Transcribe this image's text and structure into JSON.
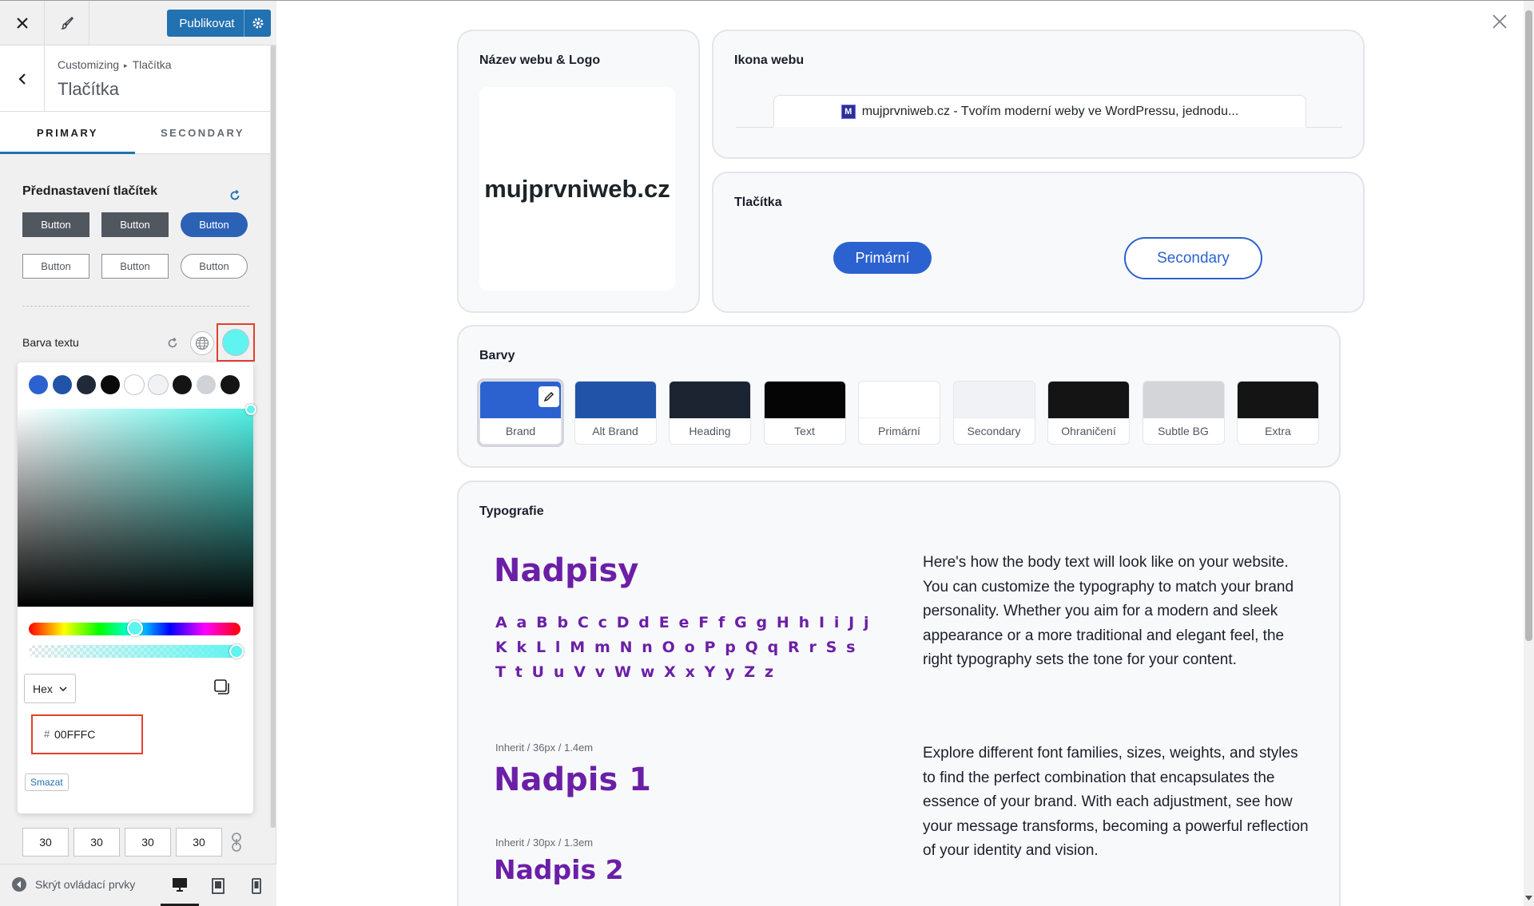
{
  "topbar": {
    "close_icon": "close-icon",
    "brush_icon": "paintbrush-icon",
    "publish_label": "Publikovat",
    "publish_settings_icon": "gear-icon"
  },
  "header": {
    "breadcrumb_root": "Customizing",
    "breadcrumb_current": "Tlačítka",
    "title": "Tlačítka"
  },
  "tabs": [
    "PRIMARY",
    "SECONDARY"
  ],
  "presets": {
    "label": "Přednastavení tlačítek",
    "buttons": [
      "Button",
      "Button",
      "Button",
      "Button",
      "Button",
      "Button"
    ]
  },
  "text_color": {
    "label": "Barva textu",
    "current_color": "#5ff4f0"
  },
  "color_picker": {
    "preset_colors": [
      "#2c62d0",
      "#2154a8",
      "#1f2937",
      "#0a0a0a",
      "#ffffff",
      "#f0f2f5",
      "#141414",
      "#cfd2d6",
      "#141414"
    ],
    "format": "Hex",
    "hash": "#",
    "hex_value": "00FFFC",
    "clear_label": "Smazat"
  },
  "padding_values": [
    "30",
    "30",
    "30",
    "30"
  ],
  "footer": {
    "hide_controls": "Skrýt ovládací prvky"
  },
  "preview": {
    "site_logo_card": {
      "title": "Název webu & Logo",
      "logo_text": "mujprvniweb.cz"
    },
    "site_icon_card": {
      "title": "Ikona webu",
      "favicon_letter": "M",
      "tab_text": "mujprvniweb.cz - Tvořím moderní weby ve WordPressu, jednodu..."
    },
    "buttons_card": {
      "title": "Tlačítka",
      "primary": "Primární",
      "secondary": "Secondary"
    },
    "colors_card": {
      "title": "Barvy",
      "colors": [
        {
          "label": "Brand",
          "hex": "#2c62d0"
        },
        {
          "label": "Alt Brand",
          "hex": "#2154a8"
        },
        {
          "label": "Heading",
          "hex": "#1c2331"
        },
        {
          "label": "Text",
          "hex": "#050505"
        },
        {
          "label": "Primární",
          "hex": "#ffffff"
        },
        {
          "label": "Secondary",
          "hex": "#f0f2f5"
        },
        {
          "label": "Ohraničení",
          "hex": "#141414"
        },
        {
          "label": "Subtle BG",
          "hex": "#d3d5d8"
        },
        {
          "label": "Extra",
          "hex": "#141414"
        }
      ]
    },
    "typography_card": {
      "title": "Typografie",
      "headings_label": "Nadpisy",
      "alphabet": [
        "A a B b C c D d E e F f G g H h I i J j",
        "K k L l M m N n O o P p Q q R r S s",
        "T t U u V v W w X x Y y Z z"
      ],
      "body_1": "Here's how the body text will look like on your website. You can customize the typography to match your brand personality. Whether you aim for a modern and sleek appearance or a more traditional and elegant feel, the right typography sets the tone for your content.",
      "h1_spec": "Inherit / 36px / 1.4em",
      "h1": "Nadpis 1",
      "h2_spec": "Inherit / 30px / 1.3em",
      "h2": "Nadpis 2",
      "body_2": "Explore different font families, sizes, weights, and styles to find the perfect combination that encapsulates the essence of your brand. With each adjustment, see how your message transforms, becoming a powerful reflection of your identity and vision."
    }
  }
}
